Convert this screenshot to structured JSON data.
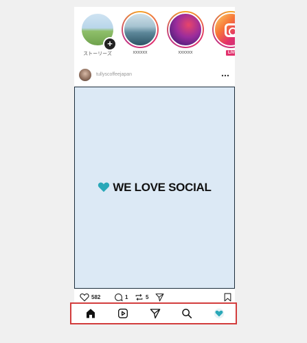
{
  "stories": [
    {
      "label": "ストーリーズ",
      "image": "meadow",
      "badge": "+"
    },
    {
      "label": "xxxxxx",
      "image": "lake"
    },
    {
      "label": "xxxxxx",
      "image": "purple-swirl"
    },
    {
      "label": "",
      "image": "instagram-logo",
      "badge": "LIVE"
    }
  ],
  "post": {
    "username": "tullyscoffeejapan",
    "more_label": "•••",
    "brand_text": "WE LOVE SOCIAL",
    "brand_color": "#2aa8b8"
  },
  "actions": {
    "likes": "582",
    "comments": "1",
    "reposts": "5"
  },
  "nav": {
    "items": [
      "home-icon",
      "reels-icon",
      "send-icon",
      "search-icon",
      "heart-icon"
    ],
    "highlight_color": "#d23b3b"
  }
}
